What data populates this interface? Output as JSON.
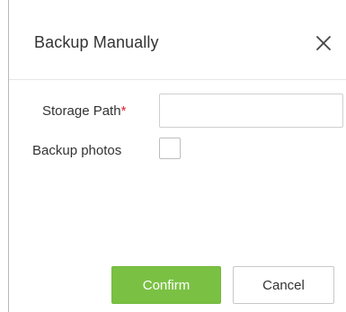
{
  "dialog": {
    "title": "Backup Manually",
    "close_icon": "close-icon"
  },
  "form": {
    "storage_path": {
      "label": "Storage Path",
      "required_mark": "*",
      "value": "",
      "placeholder": ""
    },
    "backup_photos": {
      "label": "Backup photos",
      "checked": false
    }
  },
  "buttons": {
    "confirm_label": "Confirm",
    "cancel_label": "Cancel"
  },
  "colors": {
    "accent": "#7ac143",
    "required": "#e0242b"
  }
}
